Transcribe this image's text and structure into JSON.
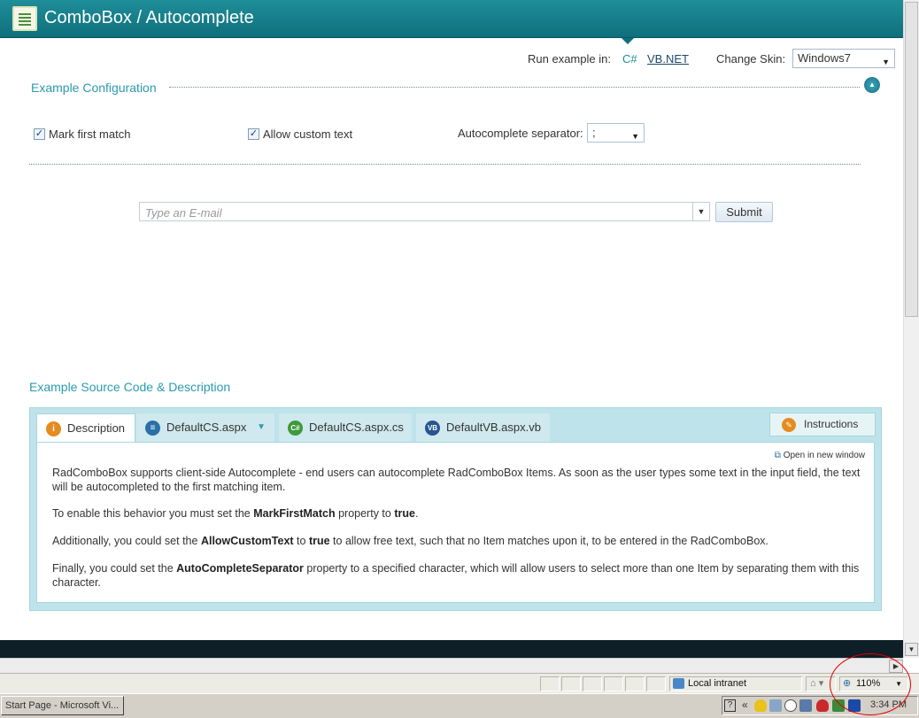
{
  "header": {
    "title": "ComboBox / Autocomplete"
  },
  "run_example": {
    "label": "Run example in:",
    "cs": "C#",
    "vb": "VB.NET"
  },
  "skin": {
    "label": "Change Skin:",
    "value": "Windows7"
  },
  "config": {
    "title": "Example Configuration",
    "mark_first_match": {
      "label": "Mark first match",
      "checked": true
    },
    "allow_custom_text": {
      "label": "Allow custom text",
      "checked": true
    },
    "separator": {
      "label": "Autocomplete separator:",
      "value": ";"
    }
  },
  "combo": {
    "placeholder": "Type an E-mail",
    "submit_label": "Submit"
  },
  "source": {
    "title": "Example Source Code & Description",
    "tabs": [
      {
        "label": "Description",
        "icon": "info-icon"
      },
      {
        "label": "DefaultCS.aspx",
        "icon": "page-icon"
      },
      {
        "label": "DefaultCS.aspx.cs",
        "icon": "cs-icon"
      },
      {
        "label": "DefaultVB.aspx.vb",
        "icon": "vb-icon"
      }
    ],
    "instructions_label": "Instructions",
    "open_new_window": "Open in new window",
    "p1": "RadComboBox supports client-side Autocomplete - end users can autocomplete RadComboBox Items. As soon as the user types some text in the input field, the text will be autocompleted to the first matching item.",
    "p2_pre": "To enable this behavior you must set the ",
    "p2_b1": "MarkFirstMatch",
    "p2_mid": " property to ",
    "p2_b2": "true",
    "p2_post": ".",
    "p3_pre": "Additionally, you could set the ",
    "p3_b1": "AllowCustomText",
    "p3_mid": " to ",
    "p3_b2": "true",
    "p3_post": " to allow free text, such that no Item matches upon it, to be entered in the RadComboBox.",
    "p4_pre": "Finally, you could set the ",
    "p4_b1": "AutoCompleteSeparator",
    "p4_post": " property to a specified character, which will allow users to select more than one Item by separating them with this character."
  },
  "statusbar": {
    "zone": "Local intranet",
    "zoom": "110%"
  },
  "taskbar": {
    "task": "Start Page - Microsoft Vi...",
    "clock": "3:34 PM"
  },
  "colors": {
    "header": "#0f6f7c",
    "accent": "#2b9bb0",
    "annotation": "#e00000"
  }
}
